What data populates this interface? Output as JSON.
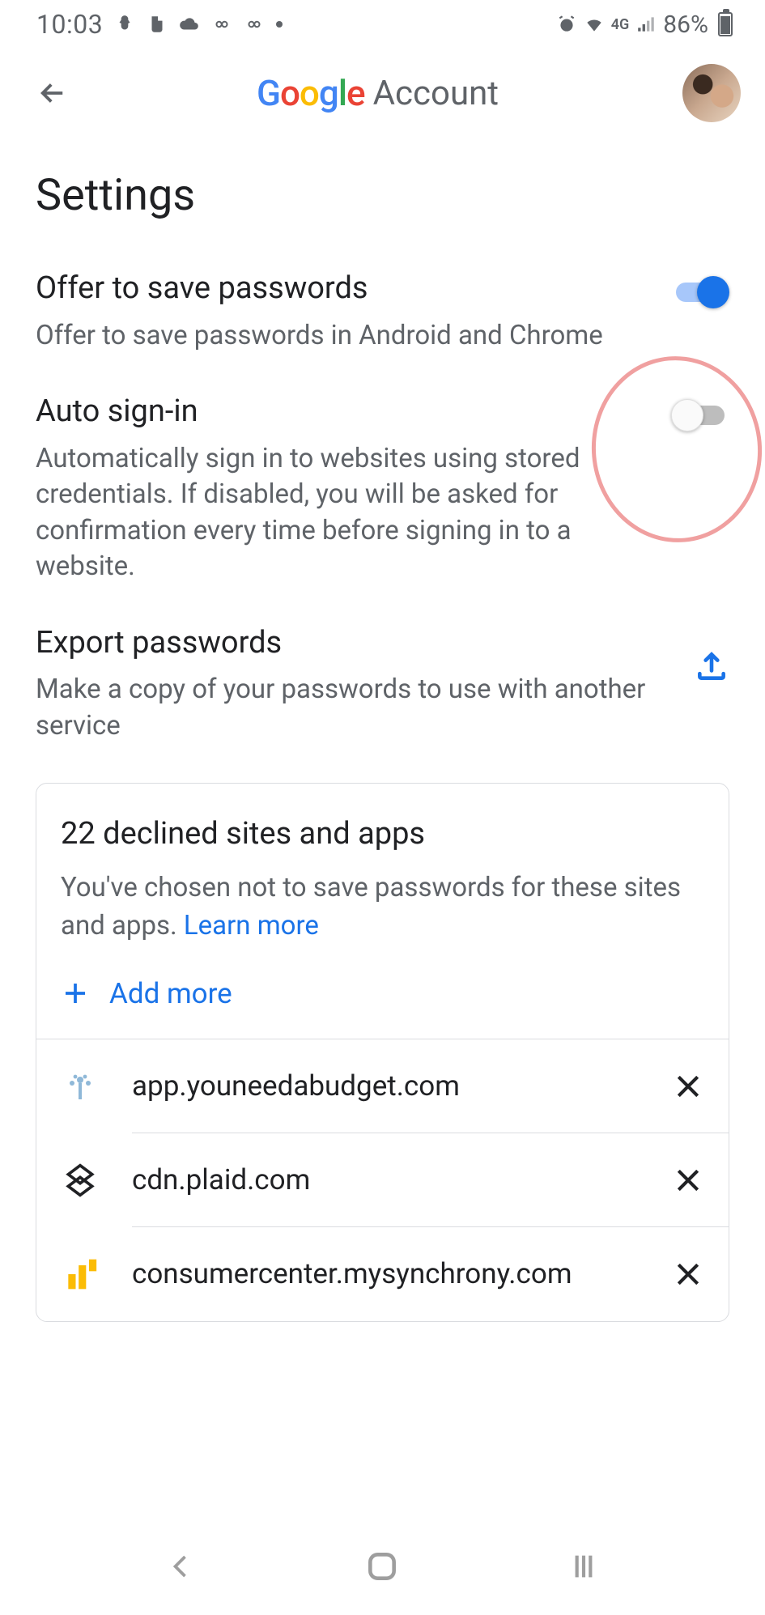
{
  "status_bar": {
    "time": "10:03",
    "network": "4G",
    "battery_pct": "86%"
  },
  "header": {
    "brand": "Google",
    "title": "Account"
  },
  "page": {
    "title": "Settings"
  },
  "settings": [
    {
      "title": "Offer to save passwords",
      "desc": "Offer to save passwords in Android and Chrome",
      "toggle_on": true
    },
    {
      "title": "Auto sign-in",
      "desc": "Automatically sign in to websites using stored credentials. If disabled, you will be asked for confirmation every time before signing in to a website.",
      "toggle_on": false
    },
    {
      "title": "Export passwords",
      "desc": "Make a copy of your passwords to use with another service"
    }
  ],
  "declined": {
    "title": "22 declined sites and apps",
    "desc": "You've chosen not to save passwords for these sites and apps. ",
    "learn_more": "Learn more",
    "add_more": "Add more",
    "sites": [
      {
        "domain": "app.youneedabudget.com",
        "icon": "tree-icon"
      },
      {
        "domain": "cdn.plaid.com",
        "icon": "lattice-icon"
      },
      {
        "domain": "consumercenter.mysynchrony.com",
        "icon": "bars-icon"
      }
    ]
  }
}
